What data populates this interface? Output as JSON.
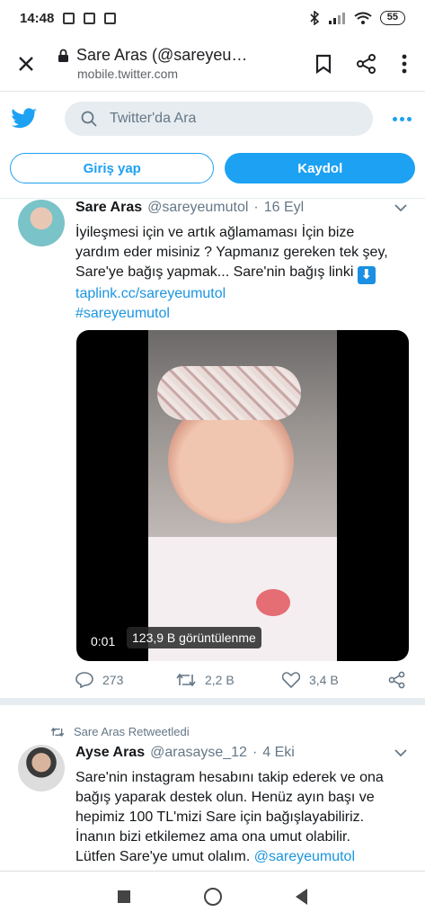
{
  "status_bar": {
    "time": "14:48",
    "battery": "55"
  },
  "browser": {
    "title": "Sare Aras (@sareyeu…",
    "url": "mobile.twitter.com"
  },
  "twitter": {
    "search_placeholder": "Twitter'da Ara",
    "login_label": "Giriş yap",
    "signup_label": "Kaydol"
  },
  "tweet1": {
    "name": "Sare Aras",
    "handle": "@sareyeumutol",
    "dot": "·",
    "date": "16 Eyl",
    "line1": "İyileşmesi için ve artık ağlamaması İçin bize",
    "line2": "yardım eder misiniz ? Yapmanız gereken tek şey,",
    "line3": "Sare'ye bağış yapmak... Sare'nin bağış linki",
    "emoji": "⬇",
    "link": "taplink.cc/sareyeumutol",
    "hashtag": "#sareyeumutol",
    "video_time": "0:01",
    "video_views": "123,9 B görüntülenme",
    "replies": "273",
    "retweets": "2,2 B",
    "likes": "3,4 B"
  },
  "retweet_note": "Sare Aras Retweetledi",
  "tweet2": {
    "name": "Ayse Aras",
    "handle": "@arasayse_12",
    "dot": "·",
    "date": "4 Eki",
    "line1": "Sare'nin instagram hesabını takip ederek ve ona",
    "line2": "bağış yaparak destek olun. Henüz ayın başı ve",
    "line3": "hepimiz 100 TL'mizi Sare için bağışlayabiliriz.",
    "line4": "İnanın bizi etkilemez ama ona umut olabilir.",
    "line5_prefix": "Lütfen Sare'ye umut olalım.",
    "line5_mention": "@sareyeumutol"
  },
  "colors": {
    "twitter_blue": "#1da1f2",
    "link": "#1b95e0",
    "muted": "#657786"
  }
}
